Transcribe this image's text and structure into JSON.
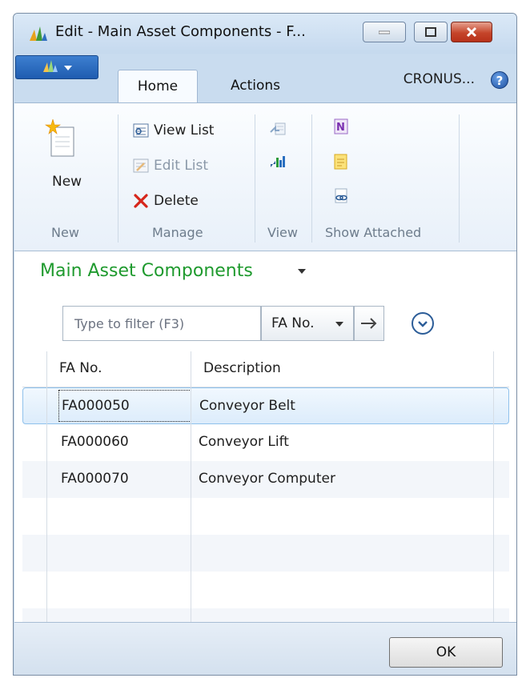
{
  "window": {
    "title": "Edit - Main Asset Components - F...",
    "controls": {
      "minimize": "minimize",
      "maximize": "maximize",
      "close": "close"
    }
  },
  "ribbon": {
    "tabs": [
      {
        "label": "Home"
      },
      {
        "label": "Actions"
      }
    ],
    "company": "CRONUS...",
    "groups": {
      "new": {
        "label": "New",
        "button": "New"
      },
      "manage": {
        "label": "Manage",
        "view_list": "View List",
        "edit_list": "Edit List",
        "delete": "Delete"
      },
      "view": {
        "label": "View"
      },
      "show_attached": {
        "label": "Show Attached"
      }
    }
  },
  "page": {
    "heading": "Main Asset Components",
    "filter": {
      "placeholder": "Type to filter (F3)",
      "field": "FA No."
    }
  },
  "grid": {
    "columns": [
      "FA No.",
      "Description"
    ],
    "rows": [
      {
        "fa_no": "FA000050",
        "description": "Conveyor Belt"
      },
      {
        "fa_no": "FA000060",
        "description": "Conveyor Lift"
      },
      {
        "fa_no": "FA000070",
        "description": "Conveyor Computer"
      }
    ],
    "selected_index": 0
  },
  "footer": {
    "ok": "OK"
  },
  "colors": {
    "heading": "#1f9a2e",
    "selection": "#dcecfb",
    "accent": "#1f5cb0"
  }
}
